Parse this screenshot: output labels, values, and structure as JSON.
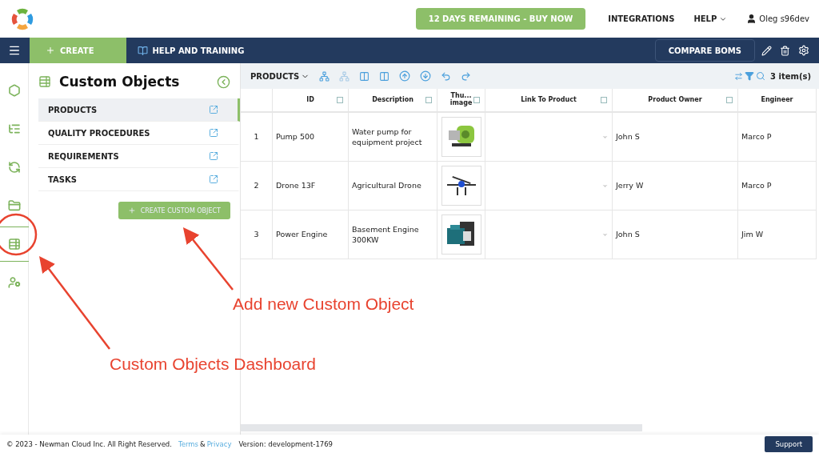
{
  "topbar": {
    "trial_button": "12 DAYS REMAINING - BUY NOW",
    "links": [
      "INTEGRATIONS",
      "HELP"
    ],
    "user": "Oleg s96dev"
  },
  "navbar": {
    "create": "CREATE",
    "help": "HELP AND TRAINING",
    "compare": "COMPARE BOMS"
  },
  "rail": [
    {
      "kind": "hexagon",
      "selected": false
    },
    {
      "kind": "tree",
      "selected": false
    },
    {
      "kind": "cycle",
      "selected": false
    },
    {
      "kind": "folder",
      "selected": false
    },
    {
      "kind": "list",
      "selected": true
    },
    {
      "kind": "user-gear",
      "selected": false
    }
  ],
  "panel": {
    "title": "Custom Objects",
    "items": [
      {
        "label": "PRODUCTS",
        "selected": true
      },
      {
        "label": "QUALITY PROCEDURES",
        "selected": false
      },
      {
        "label": "REQUIREMENTS",
        "selected": false
      },
      {
        "label": "TASKS",
        "selected": false
      }
    ],
    "create_button": "CREATE CUSTOM OBJECT"
  },
  "toolbar": {
    "dropdown": "PRODUCTS",
    "count": "3 item(s)"
  },
  "table": {
    "columns": [
      {
        "label": "ID",
        "filter": true
      },
      {
        "label": "Description",
        "filter": true
      },
      {
        "label": "Thu...\nimage",
        "filter": true
      },
      {
        "label": "Link To Product",
        "filter": true
      },
      {
        "label": "Product Owner",
        "filter": true
      },
      {
        "label": "Engineer",
        "filter": false
      }
    ],
    "rows": [
      {
        "num": "1",
        "id": "Pump 500",
        "description": "Water pump for\nequipment project",
        "owner": "John S",
        "engineer": "Marco P"
      },
      {
        "num": "2",
        "id": "Drone 13F",
        "description": "Agricultural Drone",
        "owner": "Jerry W",
        "engineer": "Marco P"
      },
      {
        "num": "3",
        "id": "Power Engine",
        "description": "Basement Engine\n300KW",
        "owner": "John S",
        "engineer": "Jim W"
      }
    ]
  },
  "footer": {
    "copyright": "© 2023 - Newman Cloud Inc. All Right Reserved.",
    "terms": "Terms",
    "amp": "&",
    "privacy": "Privacy",
    "version": "Version: development-1769",
    "support": "Support"
  },
  "annotations": [
    {
      "text": "Add new Custom Object"
    },
    {
      "text": "Custom Objects Dashboard"
    }
  ]
}
